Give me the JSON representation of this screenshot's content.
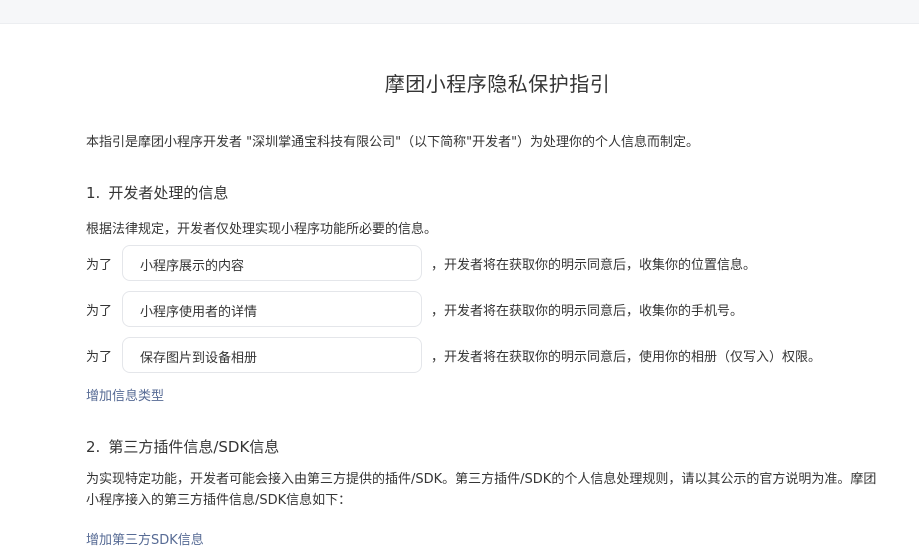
{
  "page": {
    "title": "摩团小程序隐私保护指引",
    "intro": "本指引是摩团小程序开发者 \"深圳掌通宝科技有限公司\"（以下简称\"开发者\"）为处理你的个人信息而制定。"
  },
  "section1": {
    "number": "1.",
    "title": "开发者处理的信息",
    "desc": "根据法律规定，开发者仅处理实现小程序功能所必要的信息。",
    "rows": [
      {
        "prefix": "为了",
        "purpose": "小程序展示的内容",
        "tail": "，开发者将在获取你的明示同意后，收集你的位置信息。"
      },
      {
        "prefix": "为了",
        "purpose": "小程序使用者的详情",
        "tail": "，开发者将在获取你的明示同意后，收集你的手机号。"
      },
      {
        "prefix": "为了",
        "purpose": "保存图片到设备相册",
        "tail": "，开发者将在获取你的明示同意后，使用你的相册（仅写入）权限。"
      }
    ],
    "add_link": "增加信息类型"
  },
  "section2": {
    "number": "2.",
    "title": "第三方插件信息/SDK信息",
    "paragraph": "为实现特定功能，开发者可能会接入由第三方提供的插件/SDK。第三方插件/SDK的个人信息处理规则，请以其公示的官方说明为准。摩团小程序接入的第三方插件信息/SDK信息如下：",
    "add_link": "增加第三方SDK信息"
  }
}
